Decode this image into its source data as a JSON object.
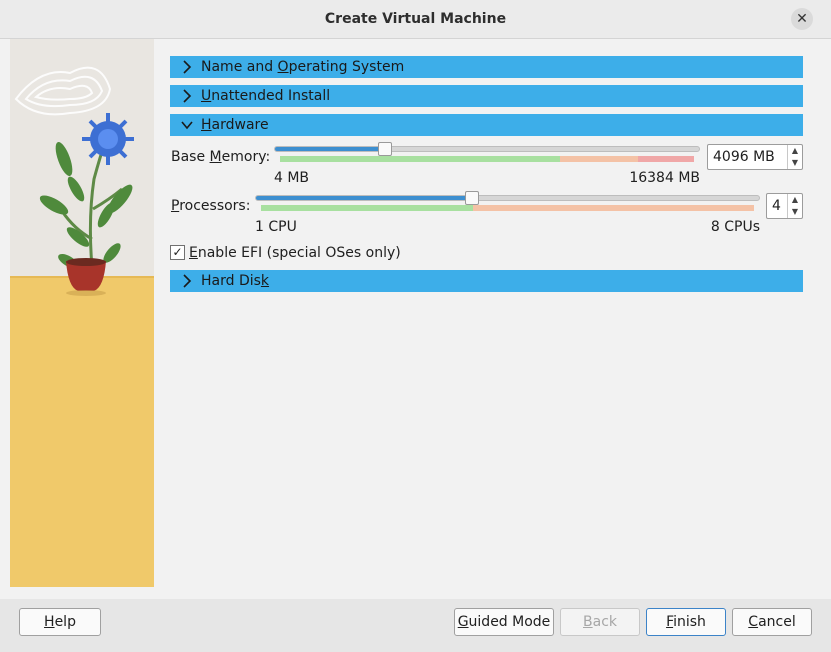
{
  "window": {
    "title": "Create Virtual Machine",
    "close_glyph": "✕"
  },
  "sections": {
    "name_os": {
      "pre": "Name and ",
      "u": "O",
      "post": "perating System"
    },
    "unattended": {
      "pre": "",
      "u": "U",
      "post": "nattended Install"
    },
    "hardware": {
      "pre": "",
      "u": "H",
      "post": "ardware"
    },
    "hard_disk": {
      "pre": "Hard Dis",
      "u": "k",
      "post": ""
    }
  },
  "memory": {
    "label_pre": "Base ",
    "label_u": "M",
    "label_post": "emory:",
    "min_label": "4 MB",
    "max_label": "16384 MB",
    "value": "4096 MB",
    "fraction": 0.26
  },
  "processors": {
    "label_pre": "",
    "label_u": "P",
    "label_post": "rocessors:",
    "min_label": "1 CPU",
    "max_label": "8 CPUs",
    "value": "4",
    "fraction": 0.43
  },
  "efi": {
    "checked": true,
    "check_glyph": "✓",
    "label_pre": "",
    "label_u": "E",
    "label_post": "nable EFI (special OSes only)"
  },
  "buttons": {
    "help": {
      "pre": "",
      "u": "H",
      "post": "elp"
    },
    "guided": {
      "pre": "",
      "u": "G",
      "post": "uided Mode"
    },
    "back": {
      "pre": "",
      "u": "B",
      "post": "ack"
    },
    "finish": {
      "pre": "",
      "u": "F",
      "post": "inish"
    },
    "cancel": {
      "pre": "",
      "u": "C",
      "post": "ancel"
    }
  },
  "colors": {
    "section_bar": "#3daee9",
    "scale_green": "#a8e0a0",
    "scale_orange": "#f4c2a6",
    "scale_red": "#f0a7a7",
    "side_wall": "#e9e6e1",
    "side_floor": "#f0c96a"
  },
  "icons": {
    "collapsed": "chevron-right-icon",
    "expanded": "chevron-down-icon",
    "spin_up": "arrow-up-icon",
    "spin_down": "arrow-down-icon"
  }
}
